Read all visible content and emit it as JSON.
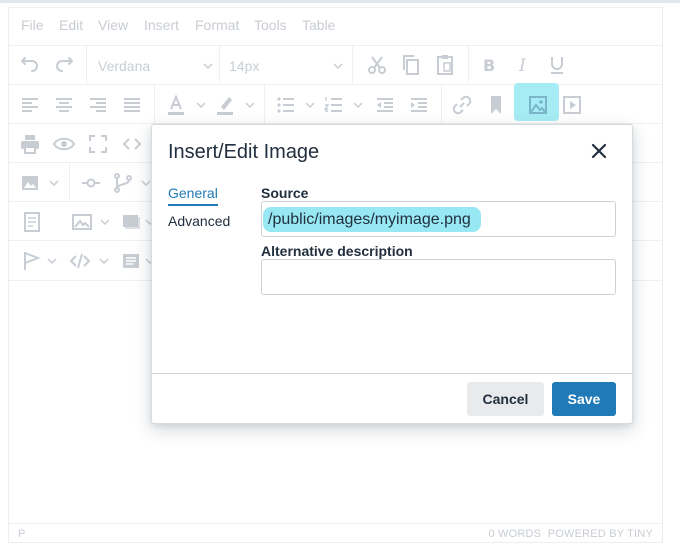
{
  "menubar": [
    "File",
    "Edit",
    "View",
    "Insert",
    "Format",
    "Tools",
    "Table"
  ],
  "toolbar": {
    "font_family": "Verdana",
    "font_size": "14px",
    "highlight_color": "#a6ecf5"
  },
  "status": {
    "path": "P",
    "word_count": "0 WORDS",
    "powered_by": "POWERED BY TINY"
  },
  "dialog": {
    "title": "Insert/Edit Image",
    "tabs": [
      {
        "label": "General",
        "active": true
      },
      {
        "label": "Advanced",
        "active": false
      }
    ],
    "source_label": "Source",
    "source_value": "/public/images/myimage.png",
    "alt_label": "Alternative description",
    "alt_value": "",
    "cancel_label": "Cancel",
    "save_label": "Save",
    "accent_color": "#207ab7"
  }
}
